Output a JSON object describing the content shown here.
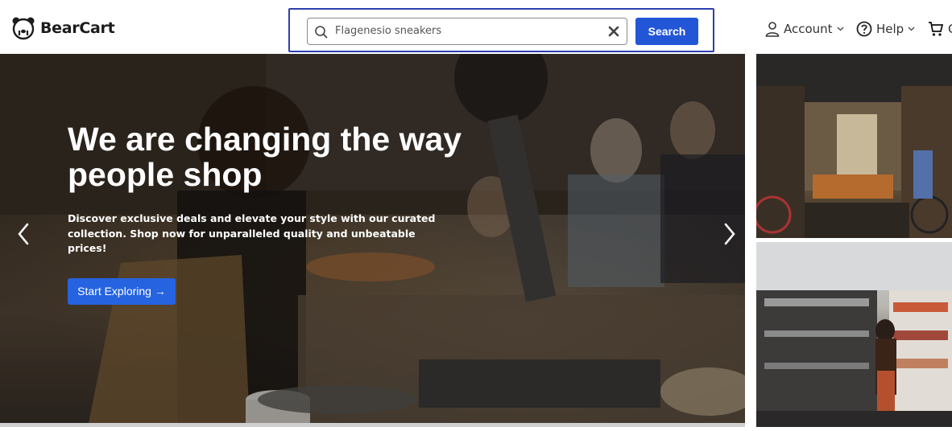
{
  "brand": {
    "name": "BearCart",
    "logo_icon": "bear-logo-icon"
  },
  "search": {
    "value": "Flagenesio sneakers",
    "button_label": "Search",
    "icons": {
      "search": "search-icon",
      "clear": "close-icon"
    }
  },
  "nav": {
    "account_label": "Account",
    "help_label": "Help",
    "icons": {
      "account": "user-icon",
      "help": "help-circle-icon",
      "cart": "cart-icon",
      "dropdown": "chevron-down-icon"
    }
  },
  "hero": {
    "title": "We are changing the way people shop",
    "subtitle": "Discover exclusive deals and elevate your style with our curated collection. Shop now for unparalleled quality and unbeatable prices!",
    "cta_label": "Start Exploring →"
  },
  "colors": {
    "accent": "#2356d6",
    "focus_outline": "#2f3fb0",
    "cta": "#2563e0"
  }
}
